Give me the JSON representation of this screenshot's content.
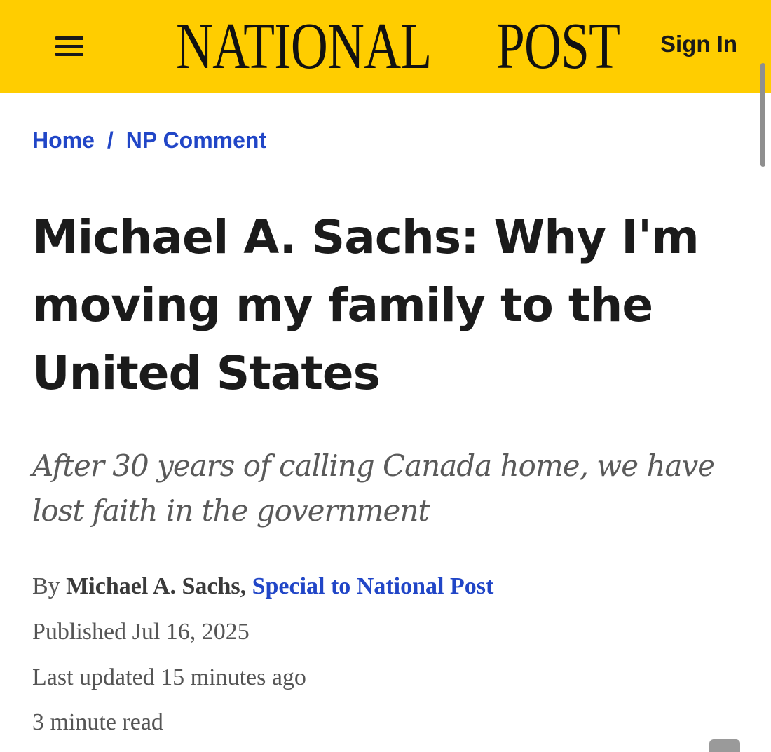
{
  "header": {
    "background_color": "#ffcd00",
    "menu_icon": "hamburger-menu-icon",
    "logo_word_1": "NATIONAL",
    "logo_icon": "maple-leaf-icon",
    "logo_word_2": "POST",
    "sign_in_label": "Sign In"
  },
  "breadcrumb": {
    "home_label": "Home",
    "separator": "/",
    "section_label": "NP Comment",
    "link_color": "#2146c7"
  },
  "article": {
    "headline": "Michael A. Sachs: Why I'm moving my family to the United States",
    "deck": "After 30 years of calling Canada home, we have lost faith in the government",
    "byline_prefix": "By",
    "author": "Michael A. Sachs,",
    "affiliation": "Special to National Post",
    "published_label": "Published",
    "published_date": "Jul 16, 2025",
    "updated_label": "Last updated",
    "updated_value": "15 minutes ago",
    "read_time": "3 minute read"
  }
}
